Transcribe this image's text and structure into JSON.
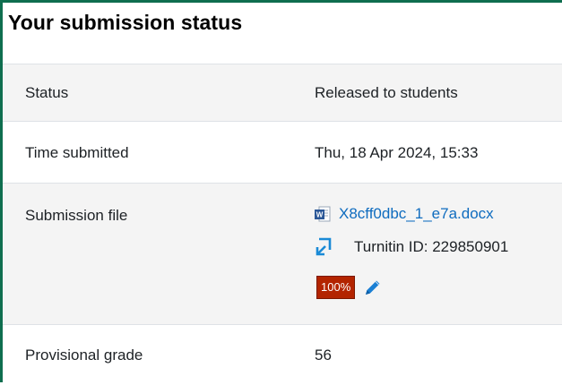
{
  "heading": "Your submission status",
  "rows": {
    "status": {
      "label": "Status",
      "value": "Released to students"
    },
    "time_submitted": {
      "label": "Time submitted",
      "value": "Thu, 18 Apr 2024, 15:33"
    },
    "submission_file": {
      "label": "Submission file",
      "file_name": "X8cff0dbc_1_e7a.docx",
      "file_icon": "word-document-icon",
      "turnitin_icon": "turnitin-icon",
      "turnitin_id": "Turnitin ID: 229850901",
      "similarity": "100%",
      "similarity_color": "#b32400",
      "edit_icon": "pencil-icon"
    },
    "provisional_grade": {
      "label": "Provisional grade",
      "value": "56"
    }
  },
  "colors": {
    "accent_border": "#0f6e4f",
    "link": "#0f6cbf",
    "shaded_row": "#f4f4f4"
  }
}
